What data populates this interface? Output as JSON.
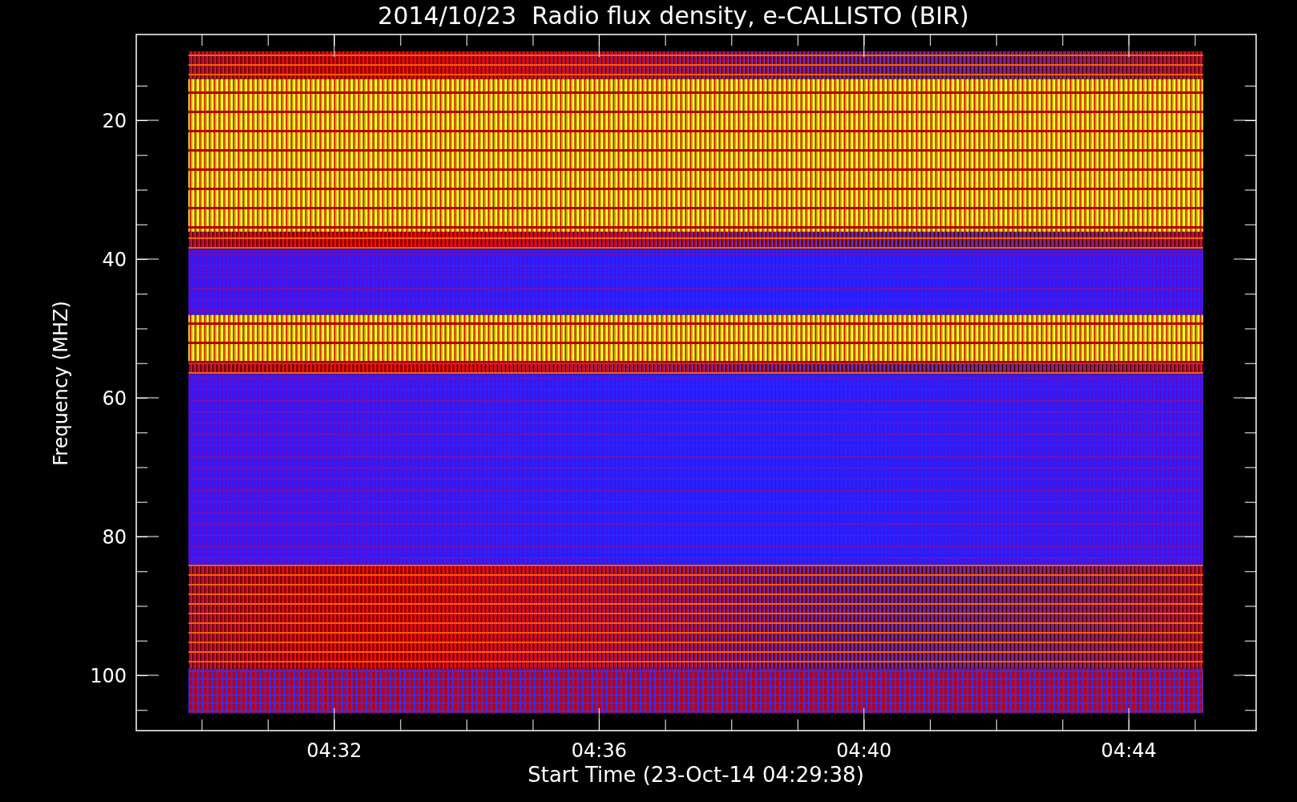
{
  "title": "2014/10/23  Radio flux density, e-CALLISTO (BIR)",
  "ylabel": "Frequency (MHZ)",
  "xlabel": "Start Time (23-Oct-14 04:29:38)",
  "yticks": [
    "20",
    "40",
    "60",
    "80",
    "100"
  ],
  "xticks": [
    "04:32",
    "04:36",
    "04:40",
    "04:44"
  ]
}
